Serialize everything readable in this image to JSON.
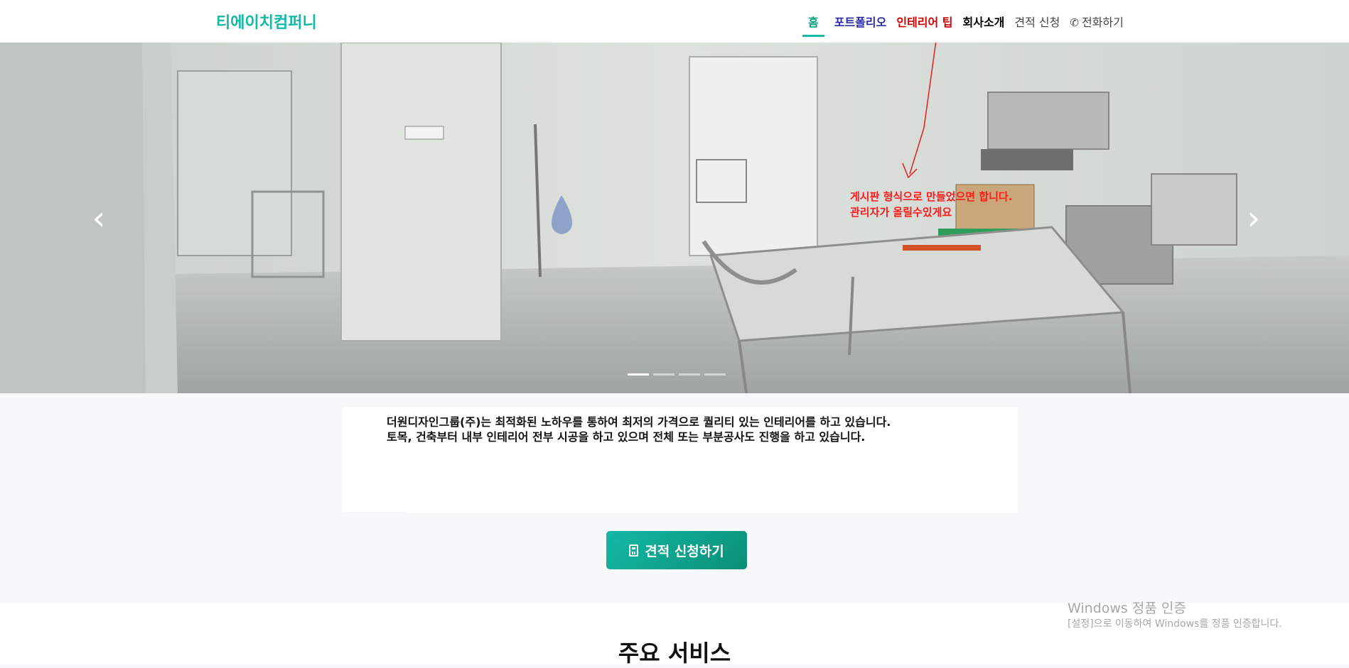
{
  "nav": {
    "brand": "티에이치컴퍼니",
    "items": {
      "home": "홈",
      "portfolio": "포트폴리오",
      "tip": "인테리어 팁",
      "company": "회사소개",
      "quote": "견적 신청",
      "phone": "전화하기"
    },
    "phone_icon": "phone-icon"
  },
  "carousel": {
    "prev_icon": "chevron-left-icon",
    "next_icon": "chevron-right-icon",
    "slides": 4,
    "active_slide": 1,
    "annotation": [
      "게시판 형식으로 만들었으면 합니다.",
      "관리자가 올릴수있게요"
    ]
  },
  "intro": {
    "lines": [
      "더원디자인그룹(주)는 최적화된 노하우를 통하여 최저의 가격으로 퀄리티 있는 인테리어를 하고 있습니다.",
      "토목, 건축부터 내부 인테리어 전부 시공을 하고 있으며 전체 또는 부분공사도 진행을 하고 있습니다."
    ]
  },
  "cta": {
    "label": "견적 신청하기",
    "icon": "calculator-icon"
  },
  "services": {
    "title": "주요 서비스"
  },
  "watermark": {
    "title": "Windows 정품 인증",
    "subtitle": "[설정]으로 이동하여 Windows를 정품 인증합니다."
  },
  "colors": {
    "accent": "#14b8a6",
    "portfolio": "#2a2aa8",
    "tip": "#d40000",
    "annotation": "#ff1a1a"
  }
}
